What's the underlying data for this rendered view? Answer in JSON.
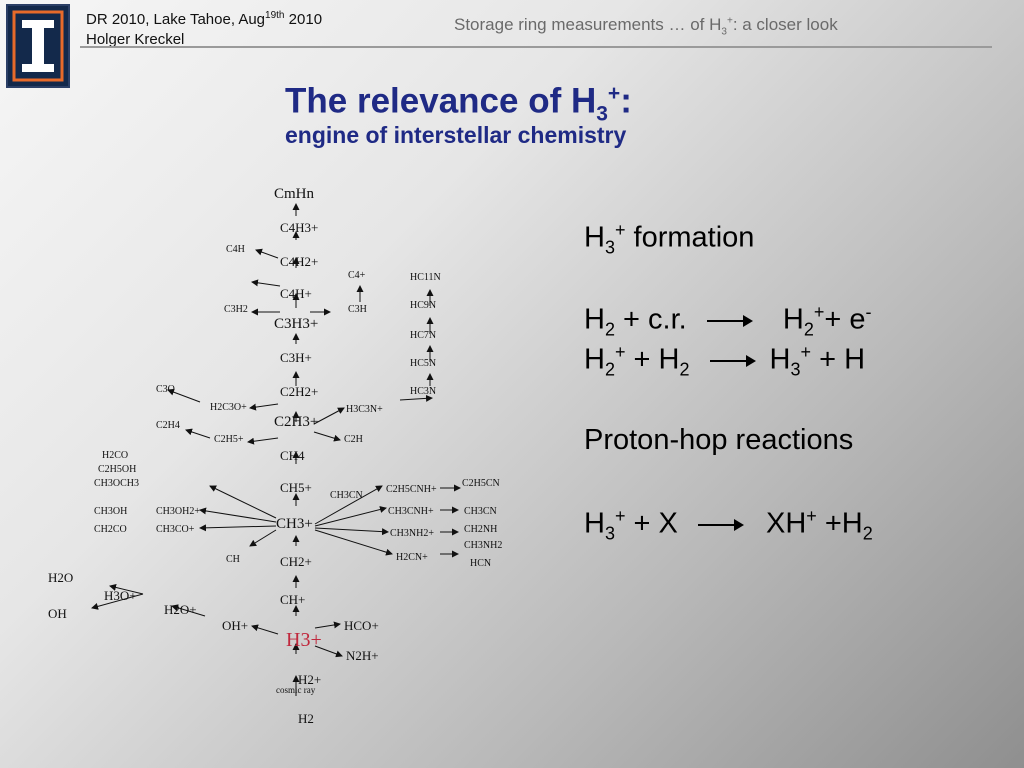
{
  "header": {
    "conference": "DR 2010, Lake Tahoe, Aug",
    "conference_sup": "19th",
    "year": " 2010",
    "author": "Holger Kreckel",
    "topic_a": "Storage ring measurements … of H",
    "topic_sub": "3",
    "topic_sup": "+",
    "topic_b": ": a closer look"
  },
  "title": {
    "text": "The relevance of H",
    "sub": "3",
    "sup": "+",
    "colon": ":"
  },
  "subtitle": "engine of interstellar chemistry",
  "diagram": {
    "labels": {
      "cmhn": "CmHn",
      "c4h3p": "C4H3+",
      "c4h2p": "C4H2+",
      "c4hp": "C4H+",
      "c4h": "C4H",
      "c3h3p": "C3H3+",
      "c3h2": "C3H2",
      "c3hp": "C3H+",
      "c2h2p": "C2H2+",
      "c2h3p": "C2H3+",
      "ch4": "CH4",
      "ch5p": "CH5+",
      "ch3p": "CH3+",
      "ch2p": "CH2+",
      "chp": "CH+",
      "h3p": "H3+",
      "h2p": "H2+",
      "h2": "H2",
      "hcop": "HCO+",
      "n2hp": "N2H+",
      "ohp": "OH+",
      "h2op": "H2O+",
      "h3op": "H3O+",
      "h2o": "H2O",
      "oh": "OH",
      "cosmic": "cosmic ray",
      "h3cnp": "H3C3N+",
      "hc3n": "HC3N",
      "hc5n": "HC5N",
      "hc7n": "HC7N",
      "hc9n": "HC9N",
      "hc11n": "HC11N",
      "c2h": "C2H",
      "c3o": "C3O",
      "h2c3op": "H2C3O+",
      "c2h4": "C2H4",
      "c2h5p": "C2H5+",
      "h2co": "H2CO",
      "c2h5oh": "C2H5OH",
      "ch3och3": "CH3OCH3",
      "ch3oh": "CH3OH",
      "ch3oh2p": "CH3OH2+",
      "ch3co": "CH2CO",
      "ch3cop": "CH3CO+",
      "ch": "CH",
      "ch3cn": "CH3CN",
      "c2h5cnhp": "C2H5CNH+",
      "c2h5cn": "C2H5CN",
      "ch3cnhp": "CH3CNH+",
      "ch3cn2": "CH3CN",
      "ch3nh2p": "CH3NH2+",
      "ch2nh": "CH2NH",
      "ch3nh2": "CH3NH2",
      "h2cnp": "H2CN+",
      "hcn": "HCN",
      "c4p": "C4+",
      "c3h": "C3H"
    }
  },
  "reactions": {
    "formation_title": "H3+ formation",
    "r1_left": "H2 + c.r.",
    "r1_right": "H2++ e-",
    "r2_left": "H2+ + H2",
    "r2_right": "H3+ + H",
    "hop_title": "Proton-hop reactions",
    "r3_left": "H3+ + X",
    "r3_right": "XH+ +H2"
  },
  "colors": {
    "title": "#1f2a85",
    "h3_highlight": "#c0283d",
    "logo_bg": "#13294b",
    "logo_accent": "#e86a2a"
  }
}
